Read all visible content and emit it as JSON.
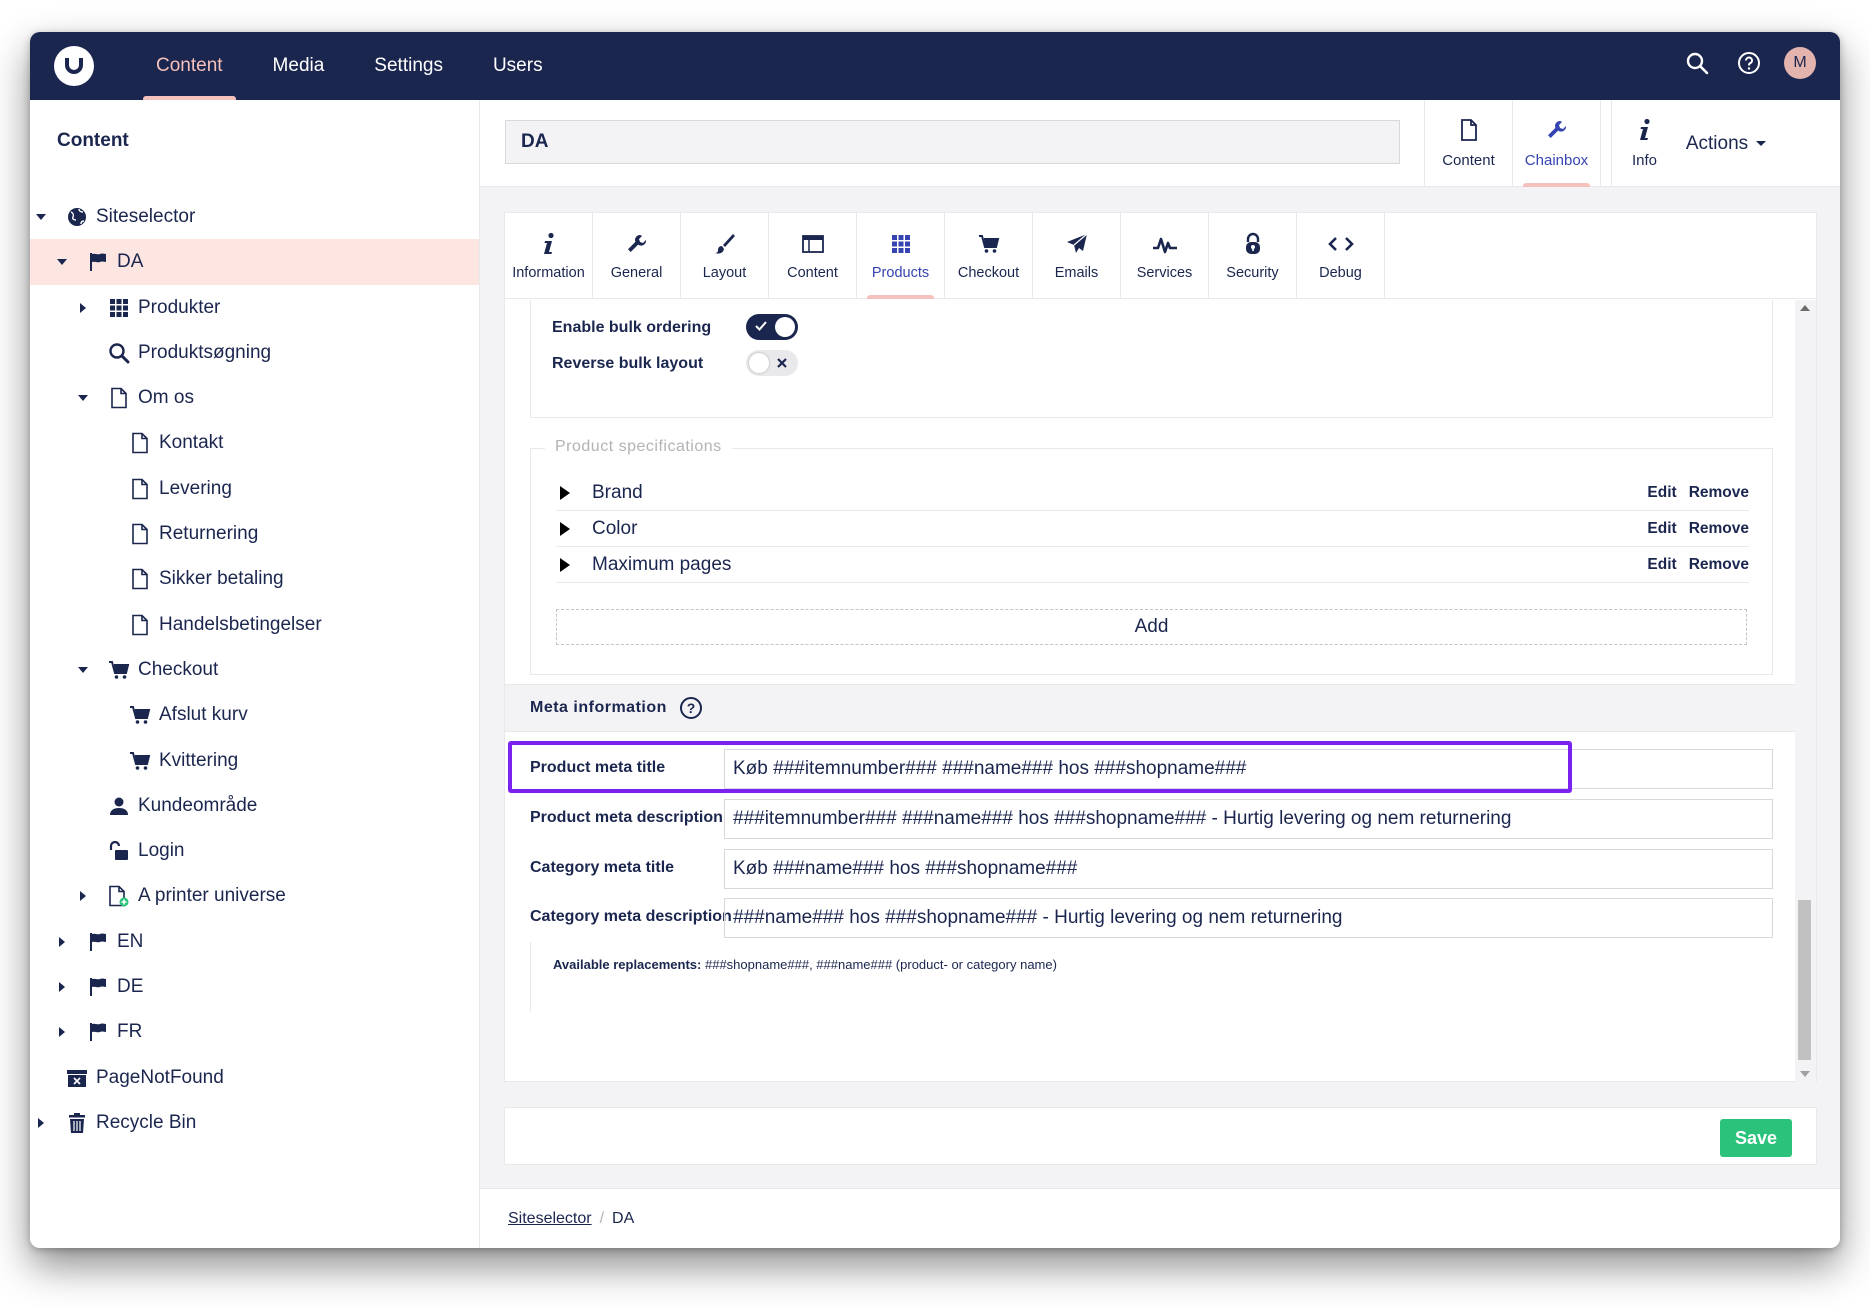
{
  "topbar": {
    "nav": [
      "Content",
      "Media",
      "Settings",
      "Users"
    ],
    "active_nav": "Content",
    "avatar_initial": "M"
  },
  "sidebar": {
    "title": "Content",
    "tree": [
      {
        "label": "Siteselector",
        "icon": "globe-icon",
        "depth": 0,
        "caret": "down"
      },
      {
        "label": "DA",
        "icon": "flag-icon",
        "depth": 1,
        "caret": "down",
        "selected": true
      },
      {
        "label": "Produkter",
        "icon": "grid-icon",
        "depth": 2,
        "caret": "right"
      },
      {
        "label": "Produktsøgning",
        "icon": "search-icon",
        "depth": 2,
        "caret": ""
      },
      {
        "label": "Om os",
        "icon": "document-icon",
        "depth": 2,
        "caret": "down"
      },
      {
        "label": "Kontakt",
        "icon": "document-icon",
        "depth": 3,
        "caret": ""
      },
      {
        "label": "Levering",
        "icon": "document-icon",
        "depth": 3,
        "caret": ""
      },
      {
        "label": "Returnering",
        "icon": "document-icon",
        "depth": 3,
        "caret": ""
      },
      {
        "label": "Sikker betaling",
        "icon": "document-icon",
        "depth": 3,
        "caret": ""
      },
      {
        "label": "Handelsbetingelser",
        "icon": "document-icon",
        "depth": 3,
        "caret": ""
      },
      {
        "label": "Checkout",
        "icon": "cart-icon",
        "depth": 2,
        "caret": "down"
      },
      {
        "label": "Afslut kurv",
        "icon": "cart-icon",
        "depth": 3,
        "caret": ""
      },
      {
        "label": "Kvittering",
        "icon": "cart-icon",
        "depth": 3,
        "caret": ""
      },
      {
        "label": "Kundeområde",
        "icon": "user-icon",
        "depth": 2,
        "caret": ""
      },
      {
        "label": "Login",
        "icon": "unlock-icon",
        "depth": 2,
        "caret": ""
      },
      {
        "label": "A printer universe",
        "icon": "document-add-icon",
        "depth": 2,
        "caret": "right"
      },
      {
        "label": "EN",
        "icon": "flag-icon",
        "depth": 1,
        "caret": "right"
      },
      {
        "label": "DE",
        "icon": "flag-icon",
        "depth": 1,
        "caret": "right"
      },
      {
        "label": "FR",
        "icon": "flag-icon",
        "depth": 1,
        "caret": "right"
      },
      {
        "label": "PageNotFound",
        "icon": "box-icon",
        "depth": 0,
        "caret": ""
      },
      {
        "label": "Recycle Bin",
        "icon": "trash-icon",
        "depth": 0,
        "caret": "right"
      }
    ]
  },
  "header": {
    "node_name": "DA",
    "apps": [
      {
        "label": "Content",
        "icon": "document-icon"
      },
      {
        "label": "Chainbox",
        "icon": "wrench-icon",
        "active": true
      },
      {
        "label": "Info",
        "icon": "info-icon"
      }
    ],
    "actions_label": "Actions"
  },
  "tabs": [
    {
      "label": "Information",
      "icon": "info-icon"
    },
    {
      "label": "General",
      "icon": "wrench-icon"
    },
    {
      "label": "Layout",
      "icon": "brush-icon"
    },
    {
      "label": "Content",
      "icon": "window-icon"
    },
    {
      "label": "Products",
      "icon": "grid-icon",
      "active": true
    },
    {
      "label": "Checkout",
      "icon": "cart-icon"
    },
    {
      "label": "Emails",
      "icon": "paper-plane-icon"
    },
    {
      "label": "Services",
      "icon": "pulse-icon"
    },
    {
      "label": "Security",
      "icon": "lock-icon"
    },
    {
      "label": "Debug",
      "icon": "code-icon"
    }
  ],
  "bulk": {
    "enable_label": "Enable bulk ordering",
    "enable_on": true,
    "reverse_label": "Reverse bulk layout",
    "reverse_on": false
  },
  "specs": {
    "legend": "Product specifications",
    "items": [
      "Brand",
      "Color",
      "Maximum pages"
    ],
    "edit_label": "Edit",
    "remove_label": "Remove",
    "add_label": "Add"
  },
  "meta": {
    "title": "Meta information",
    "fields": [
      {
        "label": "Product meta title",
        "value": "Køb ###itemnumber### ###name### hos ###shopname###"
      },
      {
        "label": "Product meta description",
        "value": "###itemnumber### ###name### hos ###shopname### - Hurtig levering og nem returnering"
      },
      {
        "label": "Category meta title",
        "value": "Køb ###name### hos ###shopname###"
      },
      {
        "label": "Category meta description",
        "value": "###name### hos ###shopname### - Hurtig levering og nem returnering"
      }
    ],
    "note_bold": "Available replacements:",
    "note_text": " ###shopname###, ###name### (product- or category name)"
  },
  "save_label": "Save",
  "breadcrumb": [
    "Siteselector",
    "DA"
  ],
  "colors": {
    "topbar": "#1b264f",
    "accent": "#f5c1bc",
    "active_tab": "#3544b1",
    "highlight": "#7b22f0",
    "save": "#2bc37c"
  }
}
